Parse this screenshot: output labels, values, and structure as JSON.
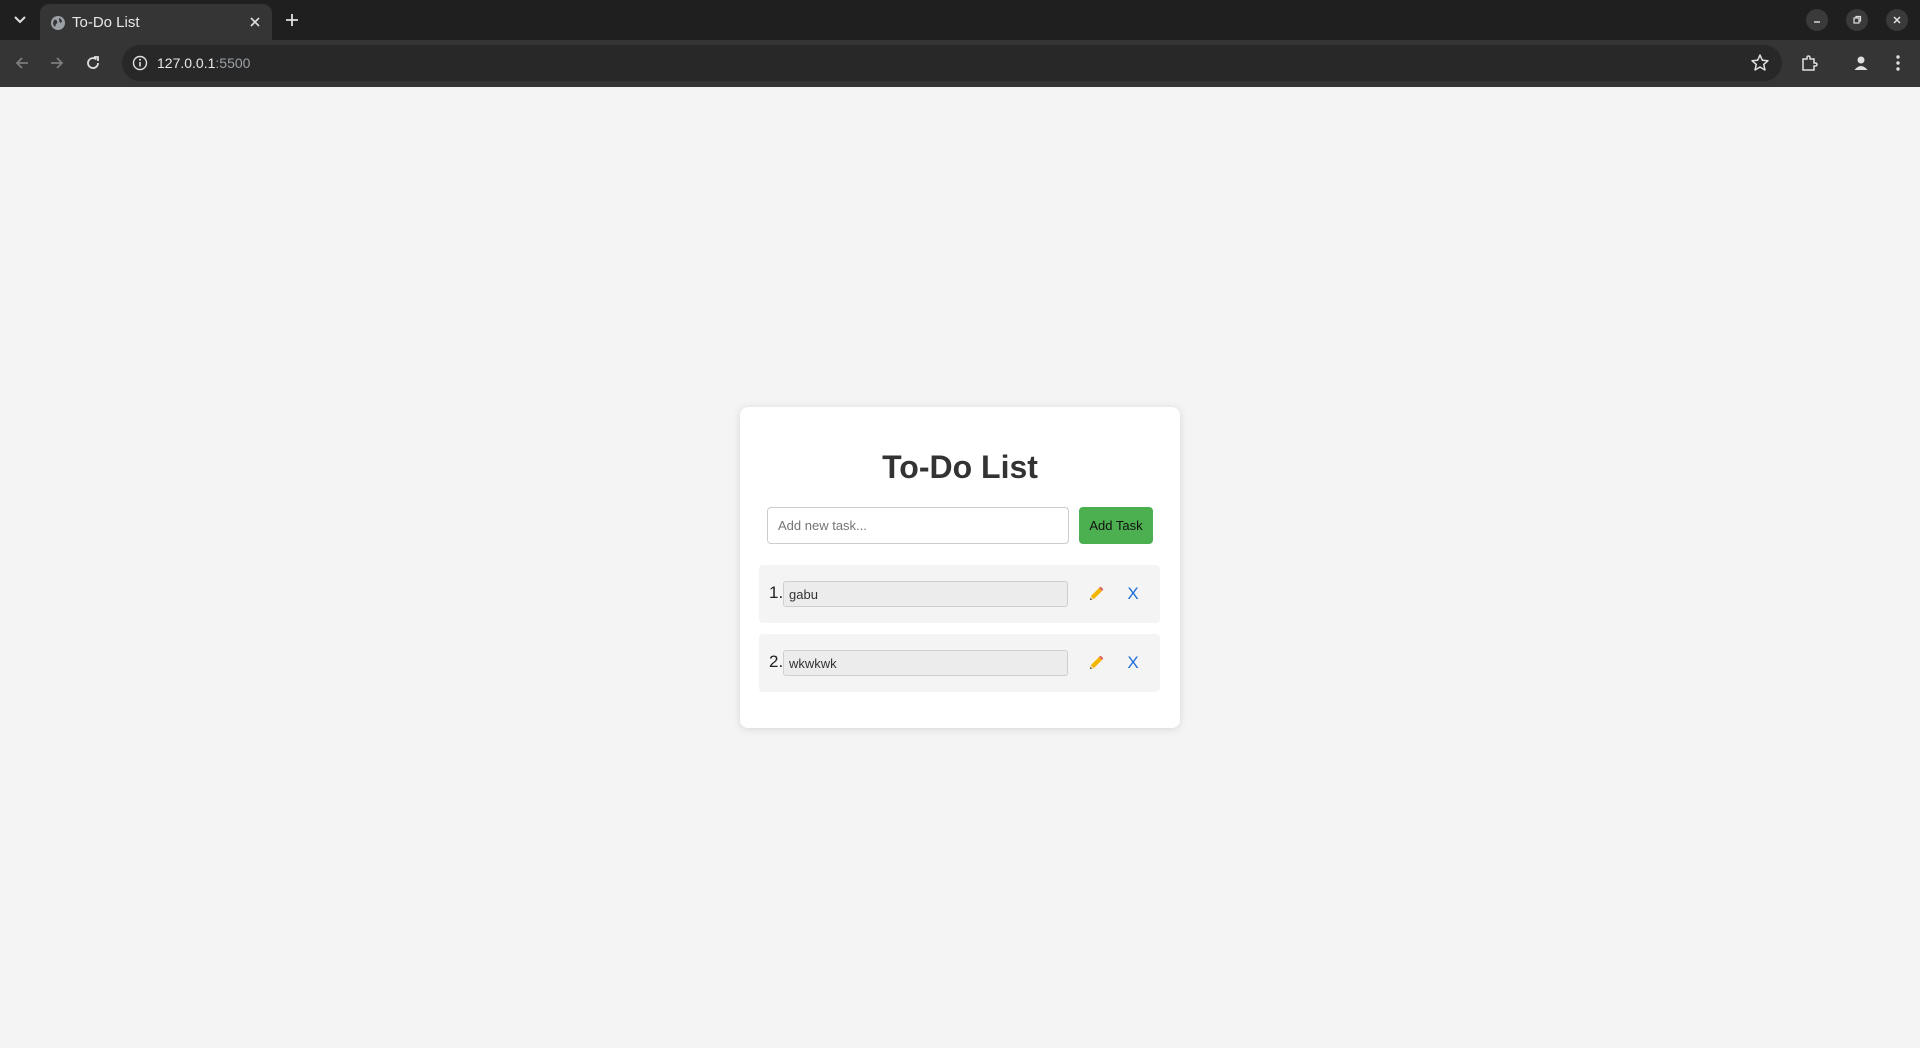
{
  "browser": {
    "tab": {
      "title": "To-Do List",
      "favicon": "globe-icon"
    },
    "url": {
      "host": "127.0.0.1",
      "port": ":5500"
    },
    "icons": [
      "tab-search-icon",
      "close-icon",
      "plus-icon",
      "minimize-icon",
      "restore-icon",
      "back-icon",
      "forward-icon",
      "reload-icon",
      "info-icon",
      "star-icon",
      "extensions-icon",
      "profile-icon",
      "menu-icon"
    ]
  },
  "app": {
    "title": "To-Do List",
    "new_task": {
      "placeholder": "Add new task...",
      "value": ""
    },
    "add_button": "Add Task",
    "accent": "#4caf50",
    "delete_color": "#1e6fd9",
    "tasks": [
      {
        "number": "1.",
        "text": "gabu",
        "delete_label": "X",
        "edit_icon": "pencil-icon"
      },
      {
        "number": "2.",
        "text": "wkwkwk",
        "delete_label": "X",
        "edit_icon": "pencil-icon"
      }
    ]
  }
}
